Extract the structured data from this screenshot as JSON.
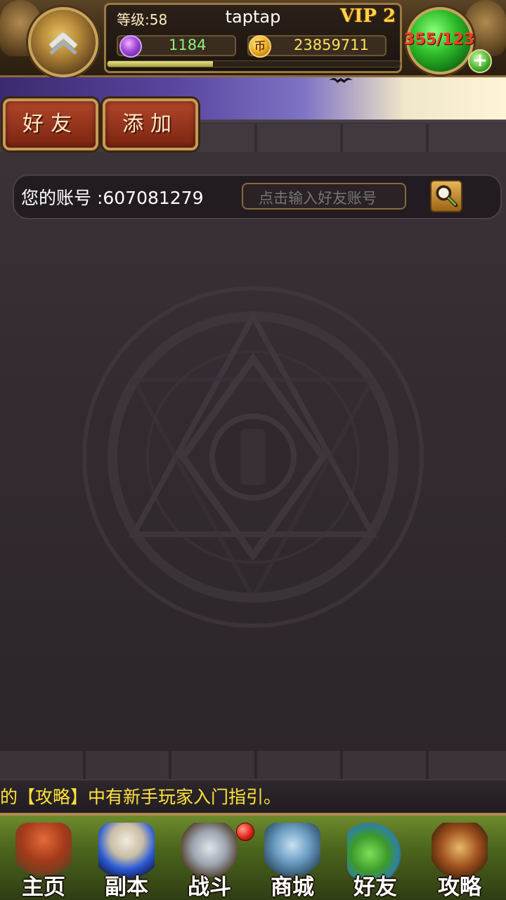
{
  "hud": {
    "level": "等级:58",
    "player_name": "taptap",
    "vip": "VIP 2",
    "gems": "1184",
    "gold": "23859711",
    "stamina": "355/123",
    "xp_progress": 0.36,
    "colors": {
      "gem_text": "#8ef07a",
      "gold_text": "#ffe05a",
      "stamina_text": "#ff3b2b",
      "vip_text": "#ffd24a"
    },
    "icons": {
      "left_orb": "chevron-up-icon",
      "gem": "gem-icon",
      "gold": "gold-coin-icon",
      "plus": "plus-icon"
    }
  },
  "tabs": [
    {
      "label": "好友"
    },
    {
      "label": "添加"
    }
  ],
  "account": {
    "label": "您的账号 :607081279",
    "search_placeholder": "点击输入好友账号",
    "search_icon": "magnifier-icon"
  },
  "ticker": {
    "text": "的【攻略】中有新手玩家入门指引。"
  },
  "nav": {
    "items": [
      {
        "label": "主页",
        "icon": "house-icon"
      },
      {
        "label": "副本",
        "icon": "skull-icon"
      },
      {
        "label": "战斗",
        "icon": "sword-axe-icon"
      },
      {
        "label": "商城",
        "icon": "owl-monster-icon"
      },
      {
        "label": "好友",
        "icon": "goblin-friends-icon"
      },
      {
        "label": "攻略",
        "icon": "guide-book-icon"
      }
    ]
  }
}
